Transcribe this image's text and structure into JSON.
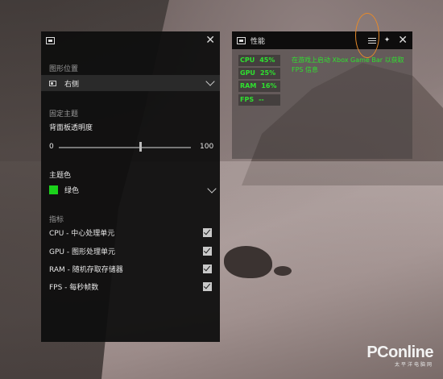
{
  "settings": {
    "position_label": "图形位置",
    "position_value": "右侧",
    "theme_label": "固定主题",
    "opacity_label": "背面板透明度",
    "slider_min": "0",
    "slider_max": "100",
    "accent_label": "主题色",
    "accent_value": "绿色",
    "accent_color": "#1bd21b",
    "metrics_label": "指标",
    "metrics": [
      {
        "label": "CPU - 中心处理单元",
        "checked": true
      },
      {
        "label": "GPU - 图形处理单元",
        "checked": true
      },
      {
        "label": "RAM - 随机存取存储器",
        "checked": true
      },
      {
        "label": "FPS - 每秒帧数",
        "checked": true
      }
    ],
    "close_icon": "close-icon",
    "title_icon": "widget-icon"
  },
  "performance": {
    "title": "性能",
    "icons": [
      "widget-icon",
      "tune-icon",
      "pin-icon",
      "close-icon"
    ],
    "stats": [
      {
        "name": "CPU",
        "value": "45%"
      },
      {
        "name": "GPU",
        "value": "25%"
      },
      {
        "name": "RAM",
        "value": "16%"
      },
      {
        "name": "FPS",
        "value": "--"
      }
    ],
    "hint": "在游戏上启动 Xbox Game Bar 以获取 FPS 信息",
    "stat_color": "#2fe12f",
    "highlight_color": "#e88a28"
  },
  "watermark": {
    "brand": "PConline",
    "sub": "太平洋电脑网"
  }
}
